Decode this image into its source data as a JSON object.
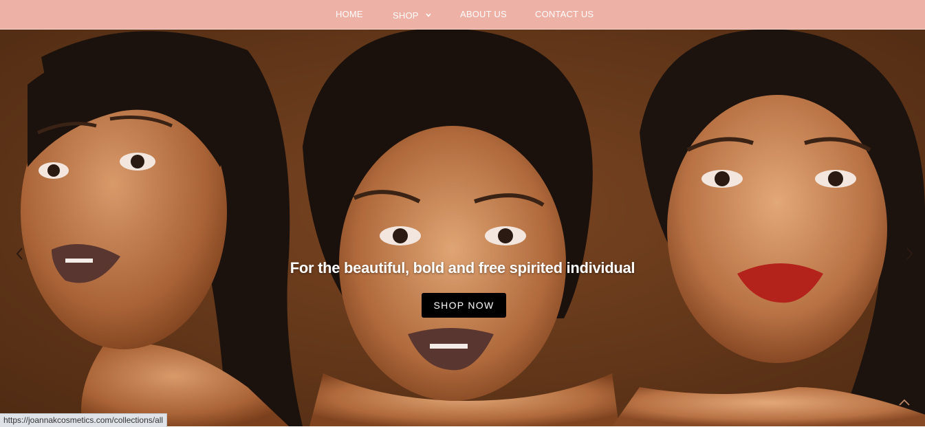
{
  "nav": {
    "items": [
      {
        "label": "HOME"
      },
      {
        "label": "SHOP"
      },
      {
        "label": "ABOUT US"
      },
      {
        "label": "CONTACT US"
      }
    ],
    "bg_color": "#edb1a6"
  },
  "hero": {
    "tagline": "For the beautiful, bold and free spirited individual",
    "cta_label": "SHOP NOW",
    "prev_icon": "chevron-left-icon",
    "next_icon": "chevron-right-icon",
    "scroll_top_icon": "chevron-up-icon",
    "bg_color": "#6e3d1c"
  },
  "status_bar": {
    "url": "https://joannakcosmetics.com/collections/all"
  }
}
